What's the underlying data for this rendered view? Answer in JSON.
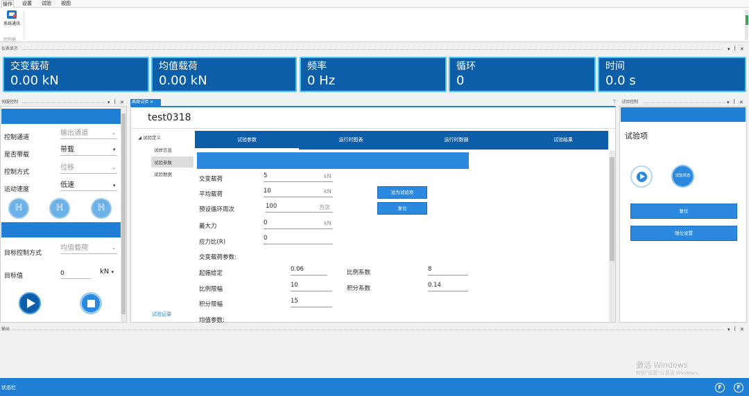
{
  "menu": {
    "items": [
      "操作",
      "设置",
      "试验",
      "视图"
    ]
  },
  "ribbon": {
    "button_label": "系统通讯",
    "group_label": "控制器"
  },
  "instrument_panel": {
    "title": "仪表显示",
    "gauges": [
      {
        "label": "交变载荷",
        "value": "0.00 kN"
      },
      {
        "label": "均值载荷",
        "value": "0.00 kN"
      },
      {
        "label": "频率",
        "value": "0 Hz"
      },
      {
        "label": "循环",
        "value": "0"
      },
      {
        "label": "时间",
        "value": "0.0 s"
      }
    ]
  },
  "servo_panel": {
    "title": "伺服控制",
    "fields": [
      {
        "label": "控制通道",
        "value": "输出通道",
        "disabled": true
      },
      {
        "label": "是否带载",
        "value": "带载",
        "disabled": false
      },
      {
        "label": "控制方式",
        "value": "位移",
        "disabled": true
      },
      {
        "label": "运动速度",
        "value": "低速",
        "disabled": false
      }
    ],
    "target_mode_label": "目标控制方式",
    "target_mode_value": "均值载荷",
    "target_value_label": "目标值",
    "target_value": "0",
    "target_unit": "kN"
  },
  "high_cycle": {
    "tab_label": "高周试验",
    "test_name": "test0318",
    "tree": {
      "root": "试验定义",
      "children": [
        "试样信息",
        "试验参数",
        "试验数据"
      ],
      "selected": "试验参数",
      "record": "试验记录"
    },
    "tabs": [
      "试验参数",
      "运行时图表",
      "运行时数据",
      "试验结果"
    ],
    "params": [
      {
        "label": "交变载荷",
        "value": "5",
        "unit": "kN"
      },
      {
        "label": "平均载荷",
        "value": "10",
        "unit": "kN"
      },
      {
        "label": "预设循环周次",
        "value": "100",
        "unit": "万次"
      },
      {
        "label": "最大力",
        "value": "0",
        "unit": "kN"
      },
      {
        "label": "应力比(R)",
        "value": "0",
        "unit": ""
      }
    ],
    "set_item_button": "设为试验项",
    "reset_button": "复位",
    "alt_section_label": "交变载荷参数:",
    "pid": [
      {
        "label": "起振给定",
        "value": "0.06"
      },
      {
        "label": "比例系数",
        "value": "8"
      },
      {
        "label": "比例限幅",
        "value": "10"
      },
      {
        "label": "积分系数",
        "value": "0.14"
      },
      {
        "label": "积分限幅",
        "value": "15"
      }
    ],
    "mean_section_label": "均值参数:"
  },
  "test_control": {
    "title": "试验控制",
    "item_label": "试验项",
    "status_button": "试验状态",
    "reset_button": "复位",
    "limit_button": "限位设置"
  },
  "output": {
    "title": "输出",
    "watermark_title": "激活 Windows",
    "watermark_sub": "转到\"设置\"以激活 Windows。"
  },
  "status": {
    "label": "状态栏",
    "icon_letter": "F"
  },
  "colors": {
    "accent": "#1e7fd4",
    "dark": "#0d5ea8",
    "glow": "#4fc3ec"
  }
}
